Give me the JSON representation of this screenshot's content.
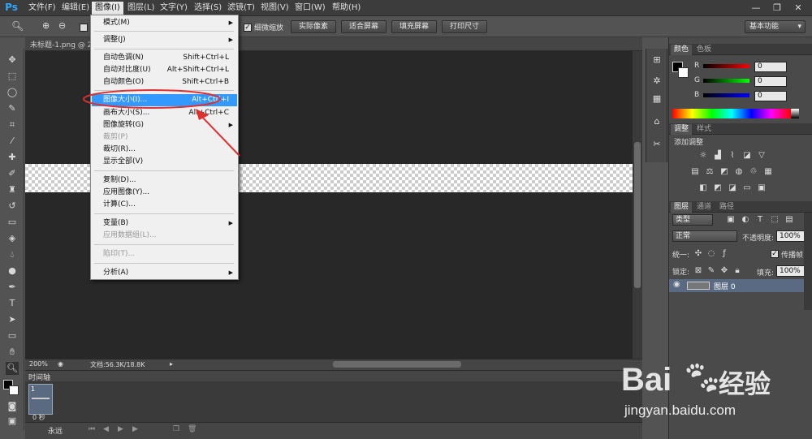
{
  "app": {
    "logo": "Ps"
  },
  "menubar": [
    {
      "label": "文件(F)"
    },
    {
      "label": "编辑(E)"
    },
    {
      "label": "图像(I)"
    },
    {
      "label": "图层(L)"
    },
    {
      "label": "文字(Y)"
    },
    {
      "label": "选择(S)"
    },
    {
      "label": "滤镜(T)"
    },
    {
      "label": "视图(V)"
    },
    {
      "label": "窗口(W)"
    },
    {
      "label": "帮助(H)"
    }
  ],
  "window_controls": {
    "minimize": "—",
    "restore": "❐",
    "close": "✕"
  },
  "options_bar": {
    "scrubby_zoom_label": "细微缩放",
    "buttons": [
      "实际像素",
      "适合屏幕",
      "填充屏幕",
      "打印尺寸"
    ],
    "workspace": "基本功能"
  },
  "document": {
    "tab_title": "未标题-1.png @ 2",
    "zoom": "200%",
    "doc_info": "文档:56.3K/18.8K"
  },
  "timeline": {
    "label": "时间轴",
    "frame_number": "1",
    "frame_delay": "0 秒",
    "loop": "永远"
  },
  "image_menu": {
    "items": [
      {
        "label": "模式(M)",
        "shortcut": "",
        "submenu": true,
        "disabled": false
      },
      {
        "label": "调整(J)",
        "shortcut": "",
        "submenu": true,
        "disabled": false
      },
      {
        "label": "自动色调(N)",
        "shortcut": "Shift+Ctrl+L",
        "submenu": false,
        "disabled": false
      },
      {
        "label": "自动对比度(U)",
        "shortcut": "Alt+Shift+Ctrl+L",
        "submenu": false,
        "disabled": false
      },
      {
        "label": "自动颜色(O)",
        "shortcut": "Shift+Ctrl+B",
        "submenu": false,
        "disabled": false
      },
      {
        "label": "图像大小(I)...",
        "shortcut": "Alt+Ctrl+I",
        "submenu": false,
        "disabled": false,
        "highlighted": true
      },
      {
        "label": "画布大小(S)...",
        "shortcut": "Alt+Ctrl+C",
        "submenu": false,
        "disabled": false
      },
      {
        "label": "图像旋转(G)",
        "shortcut": "",
        "submenu": true,
        "disabled": false
      },
      {
        "label": "裁剪(P)",
        "shortcut": "",
        "submenu": false,
        "disabled": true
      },
      {
        "label": "裁切(R)...",
        "shortcut": "",
        "submenu": false,
        "disabled": false
      },
      {
        "label": "显示全部(V)",
        "shortcut": "",
        "submenu": false,
        "disabled": false
      },
      {
        "label": "复制(D)...",
        "shortcut": "",
        "submenu": false,
        "disabled": false
      },
      {
        "label": "应用图像(Y)...",
        "shortcut": "",
        "submenu": false,
        "disabled": false
      },
      {
        "label": "计算(C)...",
        "shortcut": "",
        "submenu": false,
        "disabled": false
      },
      {
        "label": "变量(B)",
        "shortcut": "",
        "submenu": true,
        "disabled": false
      },
      {
        "label": "应用数据组(L)...",
        "shortcut": "",
        "submenu": false,
        "disabled": true
      },
      {
        "label": "陷印(T)...",
        "shortcut": "",
        "submenu": false,
        "disabled": true
      },
      {
        "label": "分析(A)",
        "shortcut": "",
        "submenu": true,
        "disabled": false
      }
    ]
  },
  "color_panel": {
    "tabs": [
      "颜色",
      "色板"
    ],
    "r": {
      "label": "R",
      "value": "0"
    },
    "g": {
      "label": "G",
      "value": "0"
    },
    "b": {
      "label": "B",
      "value": "0"
    }
  },
  "adjust_panel": {
    "tabs": [
      "调整",
      "样式"
    ],
    "title": "添加调整"
  },
  "layers_panel": {
    "tabs": [
      "图层",
      "通道",
      "路径"
    ],
    "filter_kind": "类型",
    "blend_mode": "正常",
    "opacity_label": "不透明度:",
    "opacity": "100%",
    "unify_label": "统一:",
    "propagate_label": "传播帧",
    "propagate_value": "1",
    "lock_label": "锁定:",
    "fill_label": "填充:",
    "fill": "100%",
    "layer_name": "图层 0"
  },
  "watermark": {
    "brand": "Bai",
    "brand2": "经验",
    "url": "jingyan.baidu.com"
  },
  "colors": {
    "highlight": "#3399ff",
    "annotation": "#e03030"
  }
}
